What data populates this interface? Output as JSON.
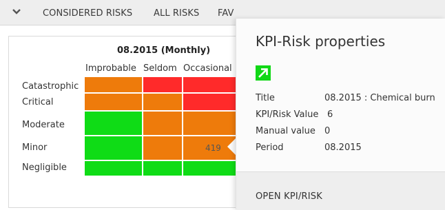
{
  "tabs": [
    {
      "label": "CONSIDERED RISKS"
    },
    {
      "label": "ALL RISKS"
    },
    {
      "label": "FAV"
    }
  ],
  "chart": {
    "title": "08.2015 (Monthly)",
    "columns": [
      "Improbable",
      "Seldom",
      "Occasional"
    ],
    "rows": [
      "Catastrophic",
      "Critical",
      "Moderate",
      "Minor",
      "Negligible"
    ],
    "selected_value": "419"
  },
  "matrix_colors": {
    "orange": "#ee7b0b",
    "red": "#ff2a2a",
    "green": "#0fdc16"
  },
  "panel": {
    "title": "KPI-Risk properties",
    "trend_icon": "arrow-up-right-icon",
    "fields": [
      {
        "label": "Title",
        "value": "08.2015 : Chemical burn"
      },
      {
        "label": "KPI/Risk Value",
        "value": "6"
      },
      {
        "label": "Manual value",
        "value": "0"
      },
      {
        "label": "Period",
        "value": "08.2015"
      }
    ],
    "open_label": "OPEN KPI/RISK"
  }
}
